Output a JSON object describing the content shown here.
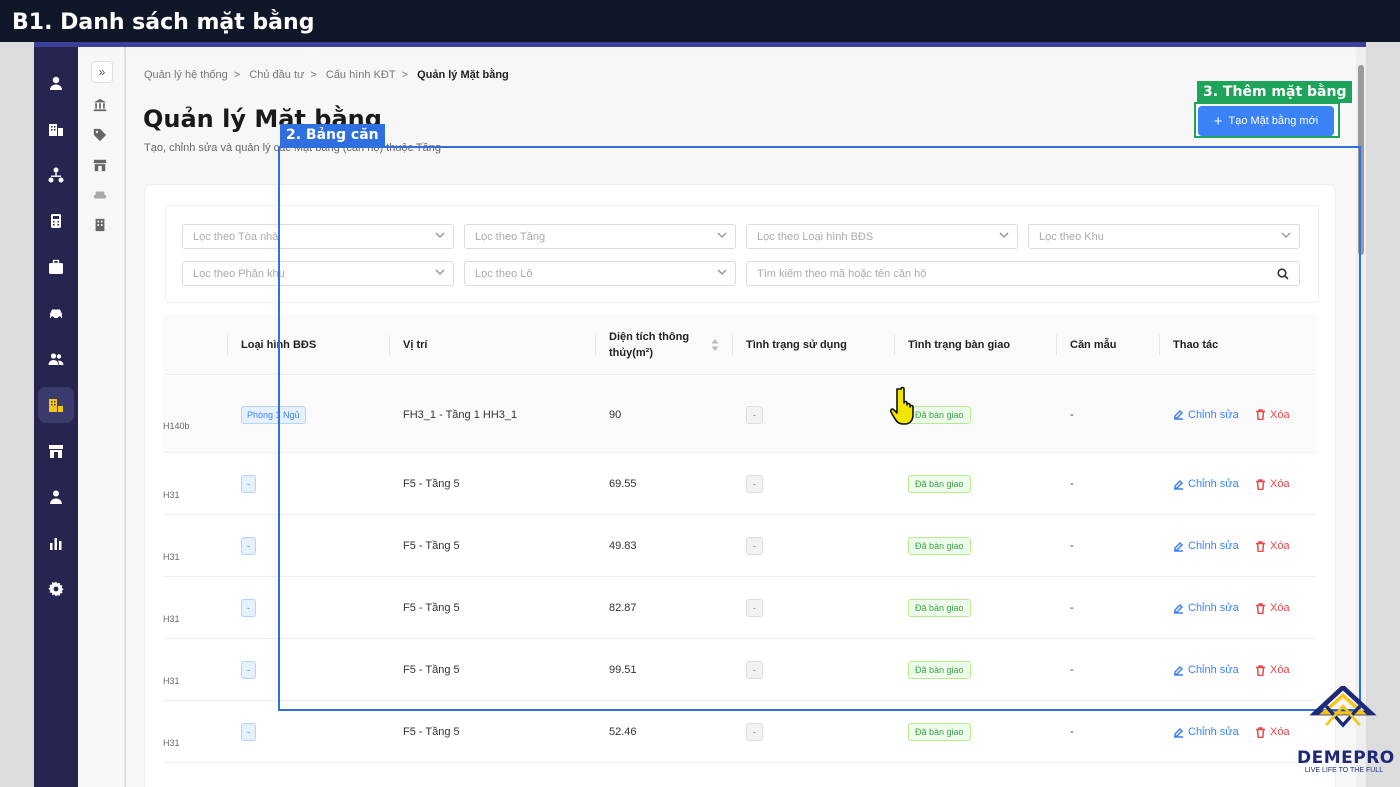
{
  "banner": {
    "title": "B1. Danh sách mặt bằng"
  },
  "breadcrumb": [
    "Quản lý hệ thống",
    "Chủ đầu tư",
    "Cấu hình KĐT",
    "Quản lý Mặt bằng"
  ],
  "page": {
    "title": "Quản lý Mặt bằng",
    "subtitle": "Tạo, chỉnh sửa và quản lý các Mặt bằng (căn hộ) thuộc Tầng",
    "create_button": "Tạo Mặt bằng mới"
  },
  "filters": {
    "building": "Lọc theo Tòa nhà",
    "floor": "Lọc theo Tầng",
    "property_type": "Lọc theo Loại hình BĐS",
    "zone": "Lọc theo Khu",
    "subzone": "Lọc theo Phân khu",
    "lot": "Lọc theo Lô",
    "search_placeholder": "Tìm kiếm theo mã hoặc tên căn hộ"
  },
  "table": {
    "headers": {
      "type": "Loại hình BĐS",
      "position": "Vị trí",
      "area": "Diện tích thông thủy(m²)",
      "usage": "Tình trạng sử dụng",
      "handover": "Tình trạng bàn giao",
      "sample": "Căn mẫu",
      "actions": "Thao tác"
    },
    "edit_label": "Chỉnh sửa",
    "delete_label": "Xóa",
    "rows": [
      {
        "code": "H140b",
        "type": "Phòng 1 Ngủ",
        "position": "FH3_1 - Tầng 1 HH3_1",
        "area": "90",
        "usage": "-",
        "handover": "Đã bàn giao",
        "sample": "-"
      },
      {
        "code": "H31",
        "type": "-",
        "position": "F5 - Tầng 5",
        "area": "69.55",
        "usage": "-",
        "handover": "Đã bàn giao",
        "sample": "-"
      },
      {
        "code": "H31",
        "type": "-",
        "position": "F5 - Tầng 5",
        "area": "49.83",
        "usage": "-",
        "handover": "Đã bàn giao",
        "sample": "-"
      },
      {
        "code": "H31",
        "type": "-",
        "position": "F5 - Tầng 5",
        "area": "82.87",
        "usage": "-",
        "handover": "Đã bàn giao",
        "sample": "-"
      },
      {
        "code": "H31",
        "type": "-",
        "position": "F5 - Tầng 5",
        "area": "99.51",
        "usage": "-",
        "handover": "Đã bàn giao",
        "sample": "-"
      },
      {
        "code": "H31",
        "type": "-",
        "position": "F5 - Tầng 5",
        "area": "52.46",
        "usage": "-",
        "handover": "Đã bàn giao",
        "sample": "-"
      }
    ]
  },
  "annotations": {
    "table_label": "2. Bảng căn",
    "create_label": "3. Thêm mặt bằng"
  },
  "logo": {
    "name": "DEMEPRO",
    "tagline": "LIVE LIFE TO THE FULL"
  },
  "colors": {
    "accent": "#3b82f6",
    "rail": "#25254f",
    "annotation_green": "#1ea45a",
    "annotation_blue": "#2f6fe0",
    "status_green": "#3ca44b",
    "danger": "#e5484d"
  },
  "icons": {
    "rail": [
      "user-icon",
      "building-icon",
      "network-icon",
      "calculator-icon",
      "briefcase-icon",
      "car-icon",
      "users-icon",
      "property-icon",
      "store-icon",
      "person-icon",
      "chart-icon",
      "gear-icon"
    ],
    "subnav": [
      "bank-icon",
      "tag-icon",
      "store-icon",
      "sofa-icon",
      "apartment-icon"
    ]
  }
}
